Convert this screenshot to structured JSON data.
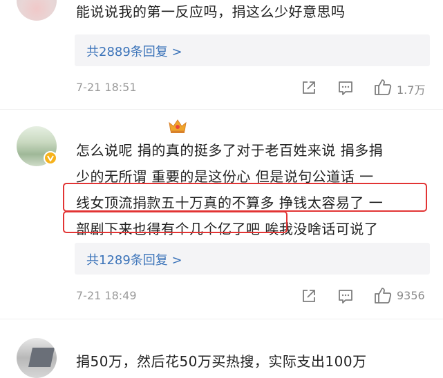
{
  "comments": [
    {
      "text": "能说说我的第一反应吗，捐这么少好意思吗",
      "replies_label": "共2889条回复 >",
      "timestamp": "7-21 18:51",
      "likes": "1.7万",
      "icons": [
        "share-icon",
        "comment-icon",
        "like-icon"
      ]
    },
    {
      "lines": [
        "怎么说呢 捐的真的挺多了对于老百姓来说 捐多捐",
        "少的无所谓 重要的是这份心 但是说句公道话 一",
        "线女顶流捐款五十万真的不算多 挣钱太容易了 一",
        "部剧下来也得有个几个亿了吧 唉我没啥话可说了"
      ],
      "replies_label": "共1289条回复 >",
      "timestamp": "7-21 18:49",
      "likes": "9356",
      "icons": [
        "share-icon",
        "comment-icon",
        "like-icon",
        "crown-badge-icon",
        "verified-badge-icon"
      ]
    },
    {
      "text": "捐50万，然后花50万买热搜，实际支出100万"
    }
  ],
  "colors": {
    "link": "#3b73b9",
    "highlight": "#e23434",
    "meta": "#9a9a9a",
    "badge": "#f6b21d"
  }
}
